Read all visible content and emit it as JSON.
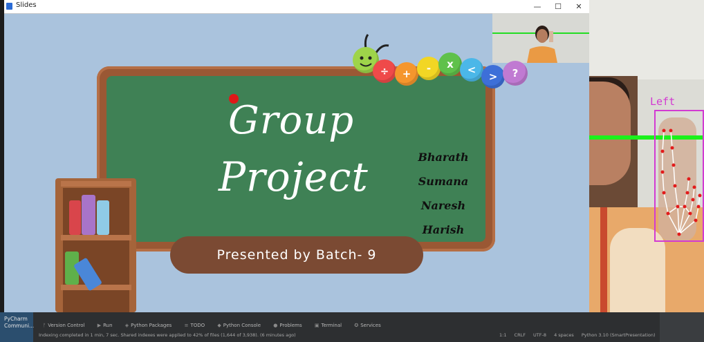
{
  "window": {
    "title": "Slides",
    "minimize": "—",
    "maximize": "☐",
    "close": "✕"
  },
  "slide": {
    "title_line1": "Group",
    "title_line2": "Project",
    "names": [
      "Bharath",
      "Sumana",
      "Naresh",
      "Harish"
    ],
    "presented_by": "Presented by Batch- 9",
    "caterpillar_symbols": [
      "÷",
      "+",
      "-",
      "x",
      "<",
      ">",
      "?"
    ]
  },
  "hand_tracking": {
    "label": "Left",
    "box_color": "#d23ad2",
    "line_color": "#1bf11b"
  },
  "ide": {
    "app_label_1": "PyCharm",
    "app_label_2": "Communi...",
    "tools": [
      {
        "icon": "version-control-icon",
        "label": "Version Control"
      },
      {
        "icon": "run-icon",
        "label": "Run"
      },
      {
        "icon": "python-packages-icon",
        "label": "Python Packages"
      },
      {
        "icon": "todo-icon",
        "label": "TODO"
      },
      {
        "icon": "python-console-icon",
        "label": "Python Console"
      },
      {
        "icon": "problems-icon",
        "label": "Problems"
      },
      {
        "icon": "terminal-icon",
        "label": "Terminal"
      },
      {
        "icon": "services-icon",
        "label": "Services"
      }
    ],
    "status_message": "Indexing completed in 1 min, 7 sec. Shared indexes were applied to 42% of files (1,644 of 3,938). (6 minutes ago)",
    "status_right": {
      "position": "1:1",
      "line_sep": "CRLF",
      "encoding": "UTF-8",
      "indent": "4 spaces",
      "interpreter": "Python 3.10 (SmartPresentation)"
    }
  }
}
